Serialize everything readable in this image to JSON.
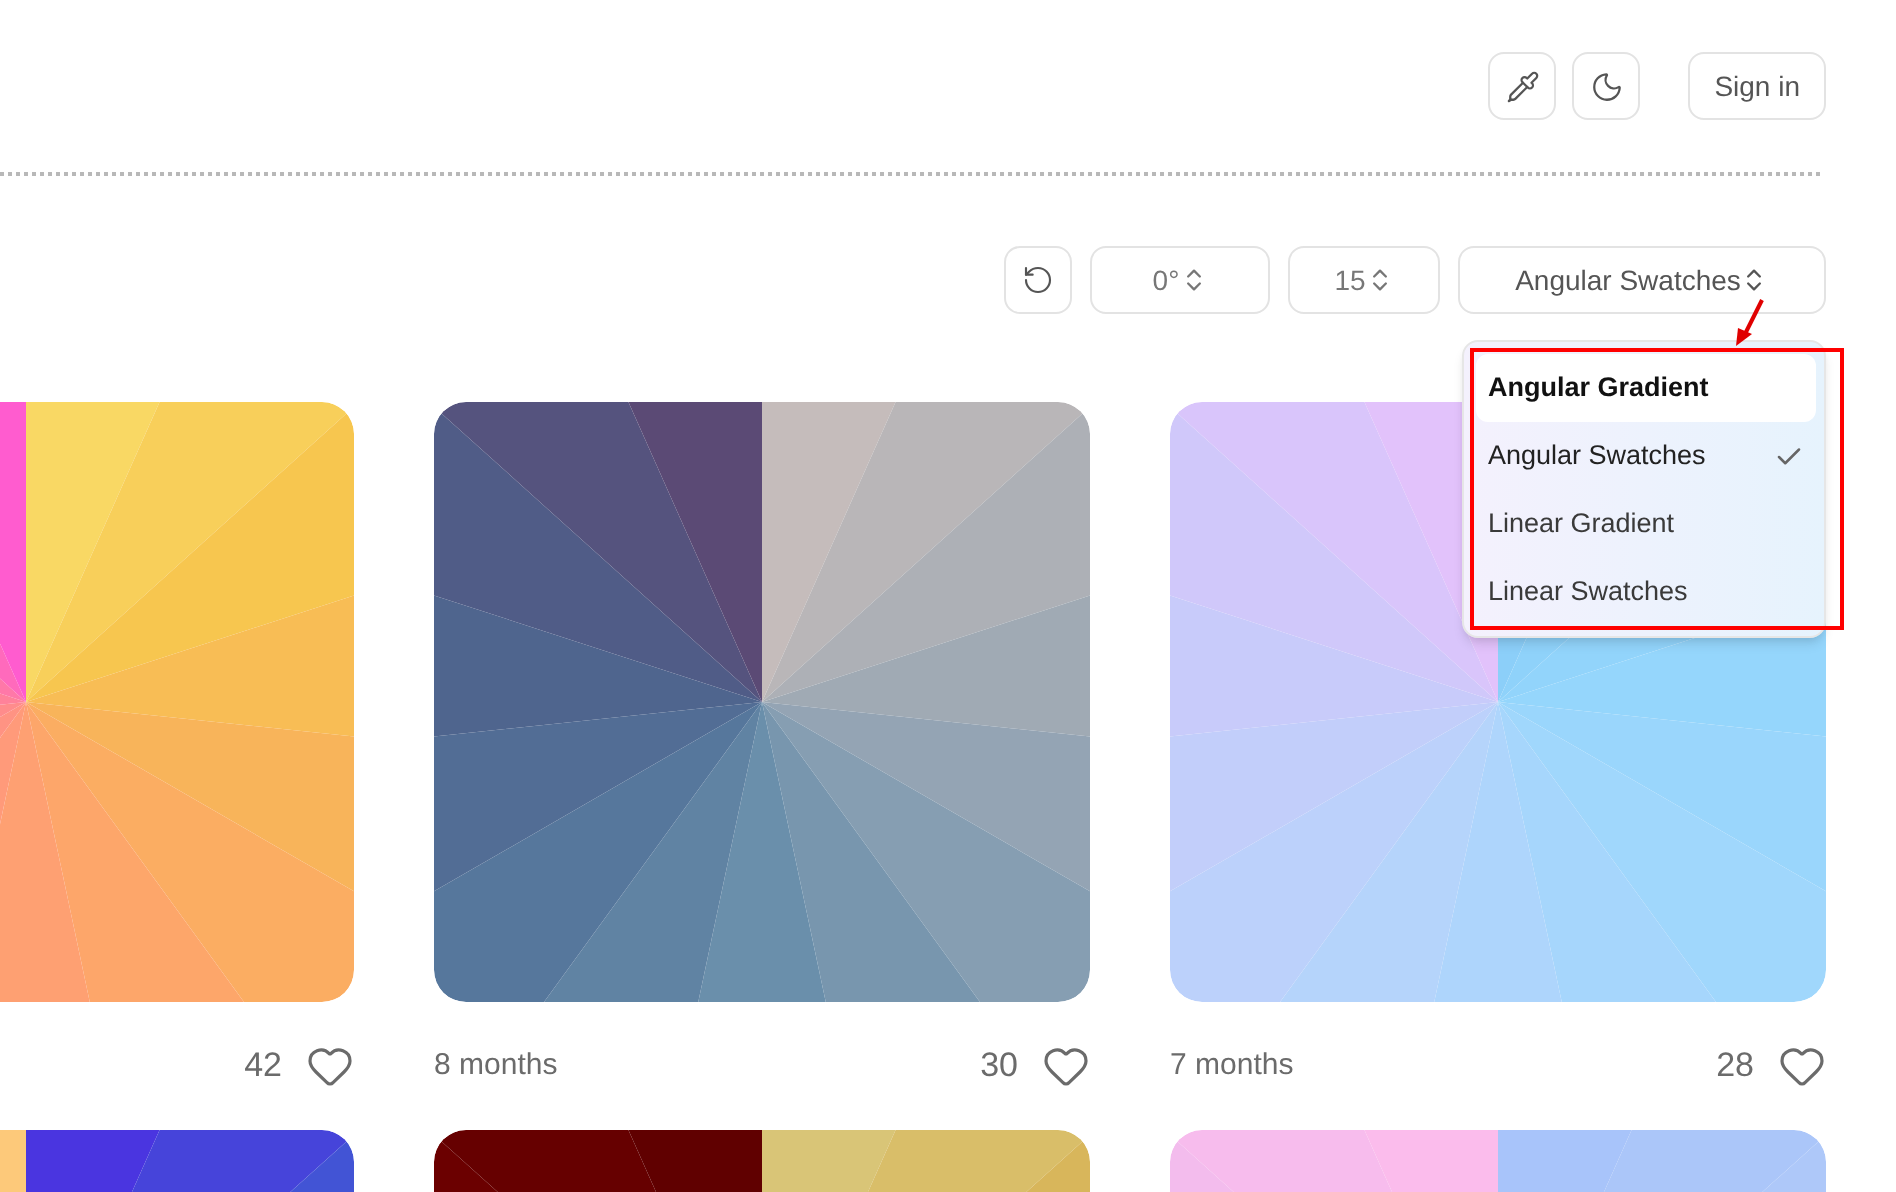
{
  "header": {
    "sign_in": "Sign in"
  },
  "toolbar": {
    "angle": "0°",
    "steps": "15",
    "mode": "Angular Swatches"
  },
  "mode_menu": [
    {
      "label": "Angular Gradient",
      "selected": false,
      "highlighted": true
    },
    {
      "label": "Angular Swatches",
      "selected": true,
      "highlighted": false
    },
    {
      "label": "Linear Gradient",
      "selected": false,
      "highlighted": false
    },
    {
      "label": "Linear Swatches",
      "selected": false,
      "highlighted": false
    }
  ],
  "cards": [
    {
      "kind": "swatches",
      "likes": "42"
    },
    {
      "kind": "swatches",
      "time": "8 months",
      "likes": "30"
    },
    {
      "kind": "swatches",
      "time": "7 months",
      "likes": "28"
    },
    {
      "kind": "swatches"
    },
    {
      "kind": "swatches"
    },
    {
      "kind": "swatches"
    }
  ]
}
